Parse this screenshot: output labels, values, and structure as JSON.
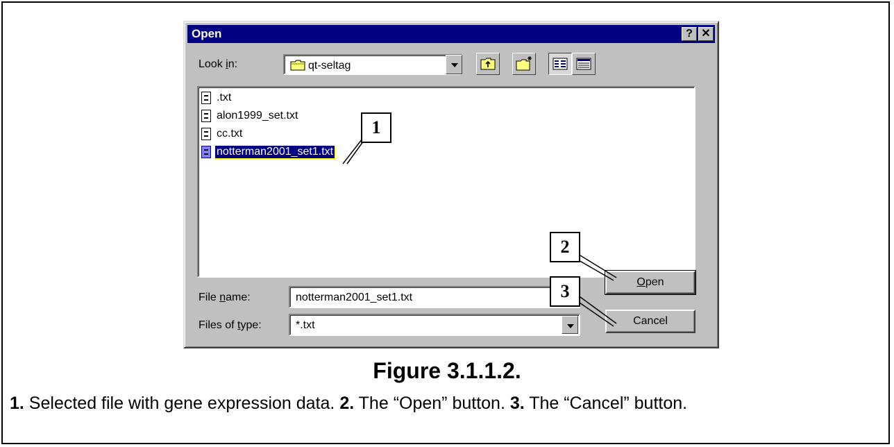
{
  "dialog": {
    "title": "Open",
    "help_button": "?",
    "close_button": "✕",
    "look_in_label_pre": "Look ",
    "look_in_label_ul": "i",
    "look_in_label_post": "n:",
    "look_in_value": "qt-seltag",
    "files": [
      {
        "name": ".txt"
      },
      {
        "name": "alon1999_set.txt"
      },
      {
        "name": "cc.txt"
      },
      {
        "name": "notterman2001_set1.txt"
      }
    ],
    "selected_file_index": 3,
    "file_name_label_pre": "File ",
    "file_name_label_ul": "n",
    "file_name_label_post": "ame:",
    "file_name_value": "notterman2001_set1.txt",
    "files_of_type_label_pre": "Files of ",
    "files_of_type_label_ul": "t",
    "files_of_type_label_post": "ype:",
    "files_of_type_value": "*.txt",
    "open_button_ul": "O",
    "open_button_post": "pen",
    "cancel_button": "Cancel"
  },
  "callouts": [
    "1",
    "2",
    "3"
  ],
  "figure": {
    "title": "Figure 3.1.1.2.",
    "caption": [
      {
        "num": "1.",
        "text": " Selected file with gene expression data. "
      },
      {
        "num": "2.",
        "text": " The “Open” button. "
      },
      {
        "num": "3.",
        "text": " The “Cancel” button."
      }
    ]
  }
}
